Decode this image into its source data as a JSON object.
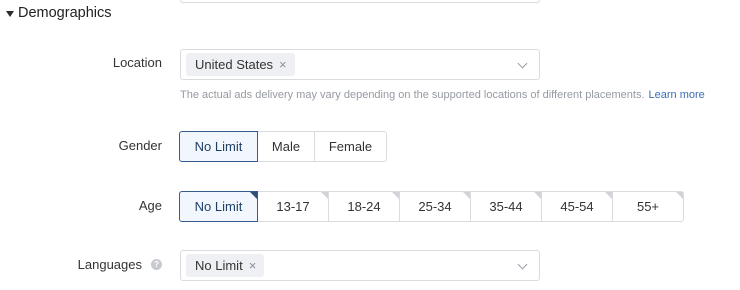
{
  "section": {
    "title": "Demographics"
  },
  "location": {
    "label": "Location",
    "tag": "United States",
    "helper_text": "The actual ads delivery may vary depending on the supported locations of different placements.",
    "learn_more": "Learn more"
  },
  "gender": {
    "label": "Gender",
    "options": [
      "No Limit",
      "Male",
      "Female"
    ],
    "selected": "No Limit"
  },
  "age": {
    "label": "Age",
    "options": [
      "No Limit",
      "13-17",
      "18-24",
      "25-34",
      "35-44",
      "45-54",
      "55+"
    ],
    "selected": "No Limit"
  },
  "languages": {
    "label": "Languages",
    "tag": "No Limit",
    "help_icon": "question-circle-icon"
  },
  "colors": {
    "selected_border": "#355c8c",
    "selected_bg": "#f2f7fd",
    "link": "#3b6fb6",
    "border": "#d9dbdf"
  }
}
